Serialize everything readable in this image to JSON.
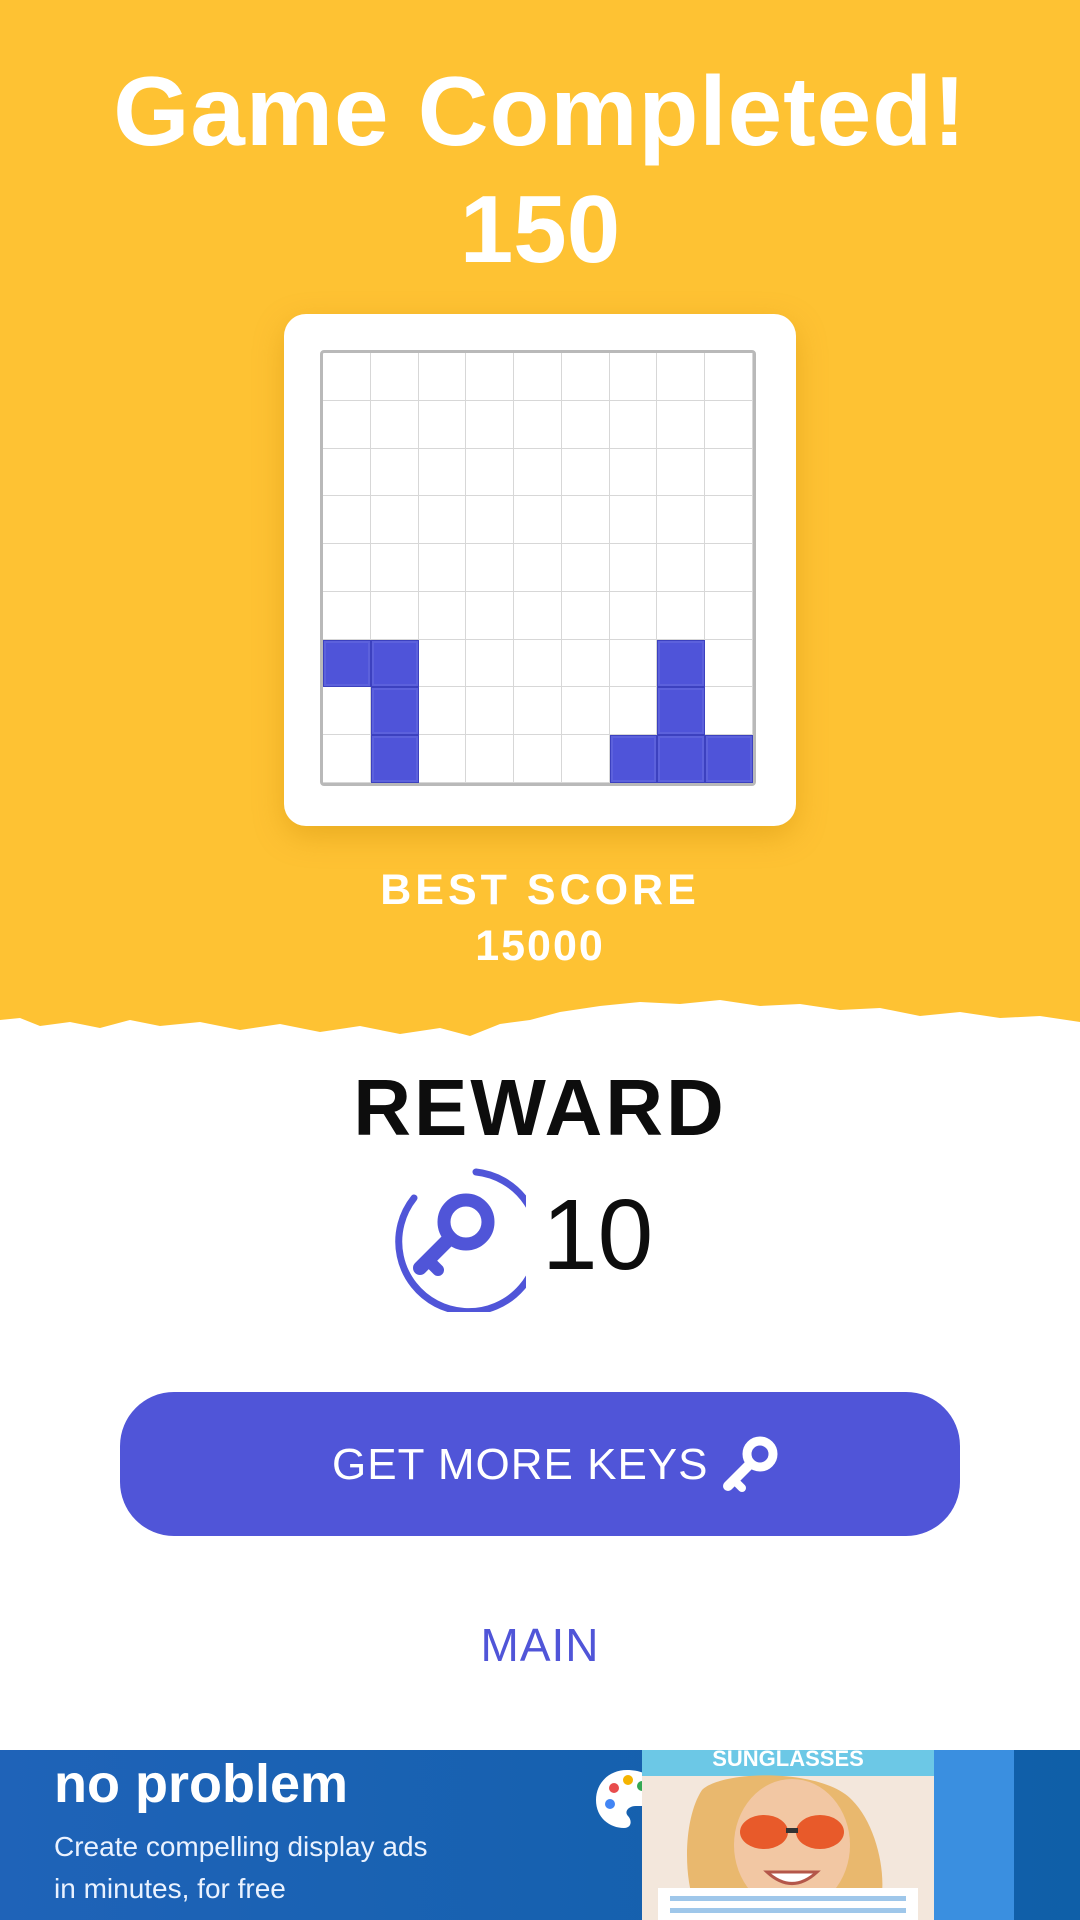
{
  "header": {
    "title": "Game Completed!",
    "score": "150"
  },
  "board": {
    "cols": 9,
    "rows": 9,
    "filled_cells": [
      [
        6,
        0
      ],
      [
        6,
        1
      ],
      [
        7,
        1
      ],
      [
        8,
        1
      ],
      [
        6,
        7
      ],
      [
        7,
        7
      ],
      [
        8,
        6
      ],
      [
        8,
        7
      ],
      [
        8,
        8
      ]
    ],
    "block_color": "#4F54D9"
  },
  "best_score": {
    "label": "BEST SCORE",
    "value": "15000"
  },
  "reward": {
    "label": "REWARD",
    "amount": "10",
    "icon": "key-icon"
  },
  "buttons": {
    "get_more_keys_label": "GET MORE KEYS",
    "main_label": "MAIN"
  },
  "ad": {
    "headline": "no problem",
    "body_line1": "Create compelling display ads",
    "body_line2": "in minutes, for free",
    "photo_title": "SUNGLASSES"
  },
  "colors": {
    "background_top": "#FEC233",
    "accent": "#5055D8",
    "text_dark": "#0d0d0d"
  }
}
